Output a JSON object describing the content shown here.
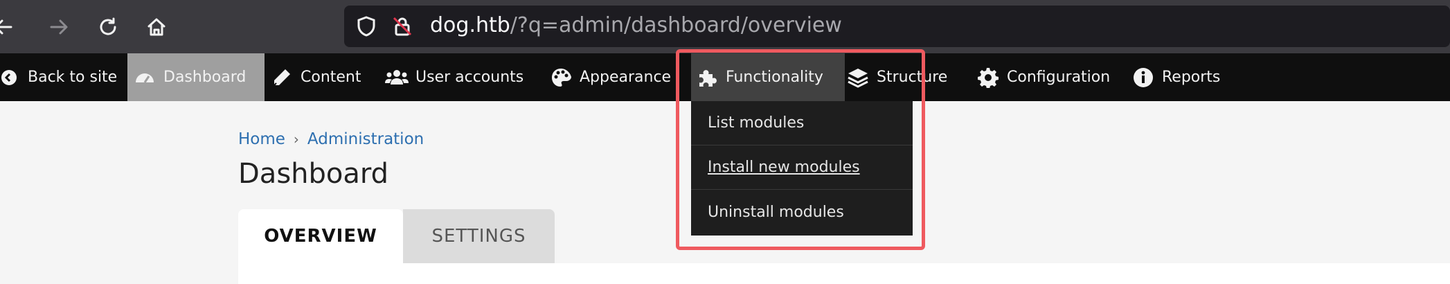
{
  "browser": {
    "url_host": "dog.htb",
    "url_path": "/?q=admin/dashboard/overview"
  },
  "toolbar": {
    "items": [
      {
        "label": "Back to site",
        "icon": "back-circle-icon"
      },
      {
        "label": "Dashboard",
        "icon": "dashboard-gauge-icon"
      },
      {
        "label": "Content",
        "icon": "pencil-icon"
      },
      {
        "label": "User accounts",
        "icon": "users-icon"
      },
      {
        "label": "Appearance",
        "icon": "palette-icon"
      },
      {
        "label": "Functionality",
        "icon": "puzzle-icon"
      },
      {
        "label": "Structure",
        "icon": "layers-icon"
      },
      {
        "label": "Configuration",
        "icon": "gear-icon"
      },
      {
        "label": "Reports",
        "icon": "info-icon"
      }
    ]
  },
  "dropdown": {
    "items": [
      {
        "label": "List modules"
      },
      {
        "label": "Install new modules"
      },
      {
        "label": "Uninstall modules"
      }
    ]
  },
  "breadcrumb": {
    "home": "Home",
    "separator": "›",
    "admin": "Administration"
  },
  "page": {
    "title": "Dashboard",
    "tabs": [
      {
        "label": "OVERVIEW"
      },
      {
        "label": "SETTINGS"
      }
    ]
  },
  "colors": {
    "highlight": "#ef5a5f",
    "link": "#2d6fb0",
    "toolbar_bg": "#0f0f0f"
  }
}
